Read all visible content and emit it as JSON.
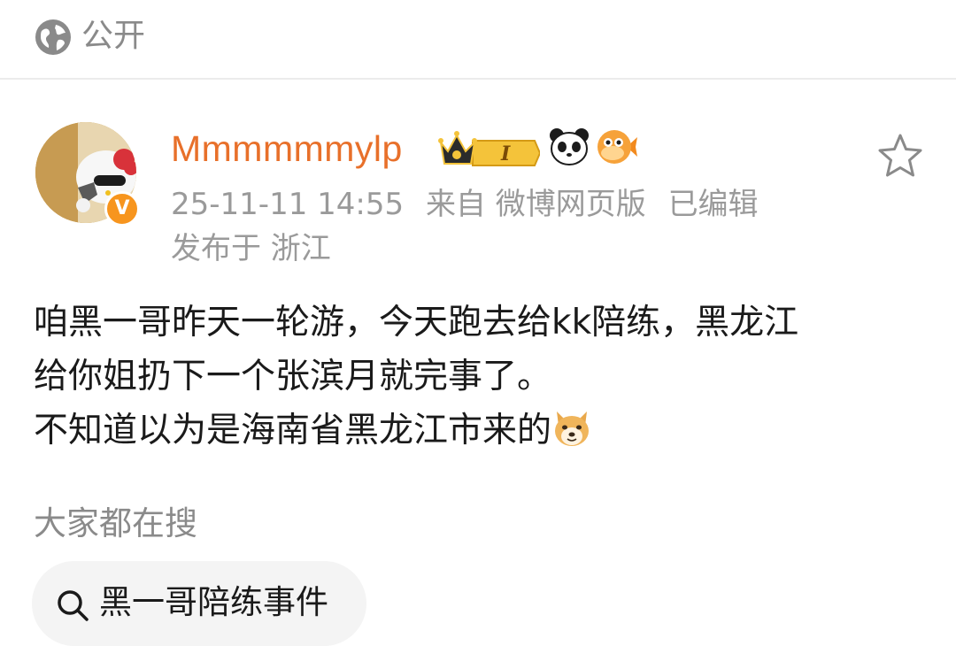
{
  "visibility": {
    "label": "公开",
    "icon": "globe-icon"
  },
  "post": {
    "author": {
      "name": "Mmmmmmylp",
      "verified_mark": "V",
      "badges": [
        "crown-level-badge",
        "panda-icon",
        "puffer-fish-icon"
      ],
      "level_label": "I"
    },
    "time": "25-11-11 14:55",
    "source": "来自 微博网页版",
    "edited": "已编辑",
    "location": "发布于 浙江",
    "content_lines": [
      "咱黑一哥昨天一轮游，今天跑去给kk陪练，黑龙江",
      "给你姐扔下一个张滨月就完事了。",
      "不知道以为是海南省黑龙江市来的"
    ]
  },
  "hot_search": {
    "title": "大家都在搜",
    "query": "黑一哥陪练事件"
  },
  "colors": {
    "username": "#e8702a",
    "meta": "#9a9a9a",
    "verified": "#f7951e"
  }
}
